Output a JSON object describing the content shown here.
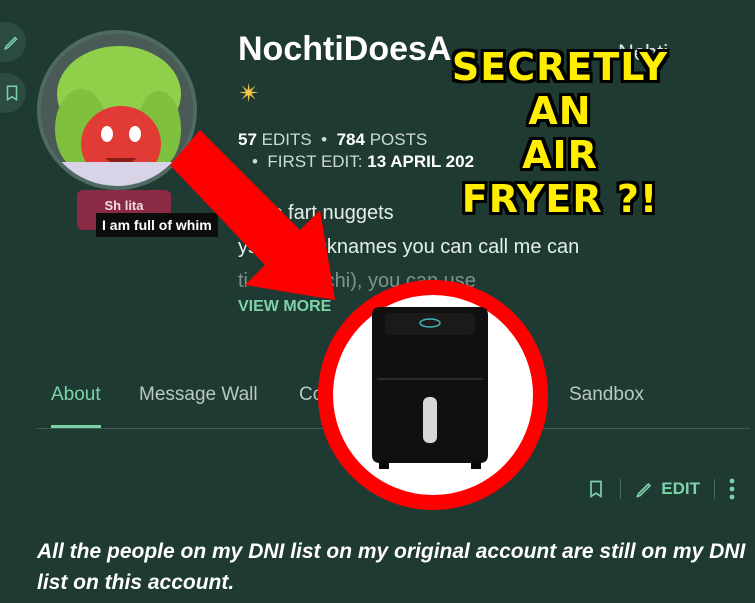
{
  "profile": {
    "username": "NochtiDoesA",
    "alt_name": "Nchti",
    "sparkle_icon": "sparkle-icon",
    "stats": {
      "edits_count": "57",
      "edits_label": "EDITS",
      "posts_count": "784",
      "posts_label": "POSTS",
      "first_edit_label": "FIRST EDIT:",
      "first_edit_date": "13 APRIL 202"
    },
    "badge_label": "Sh lita",
    "tooltip": "I am full of whim",
    "bio_lines": [
      "at up fart nuggets",
      "ys, my nicknames you can call me can",
      "ti or N         mochi), you can use"
    ],
    "view_more": "VIEW MORE"
  },
  "tabs": [
    {
      "label": "About",
      "active": true
    },
    {
      "label": "Message Wall",
      "active": false
    },
    {
      "label": "Co",
      "active": false
    },
    {
      "label": "Sandbox",
      "active": false
    }
  ],
  "toolbar": {
    "edit_label": "EDIT"
  },
  "content": {
    "paragraph": "All the people on my DNI list on my original account are still on my DNI list on this account."
  },
  "overlay": {
    "caption_lines": [
      "SECRETLY",
      "AN",
      "AIR",
      "FRYER ?!"
    ]
  },
  "colors": {
    "background": "#1f3a33",
    "accent": "#7dd3a8",
    "caption": "#ffee00",
    "ring": "#ff0000",
    "arrow": "#ff0000",
    "badge": "#8b2a45"
  }
}
